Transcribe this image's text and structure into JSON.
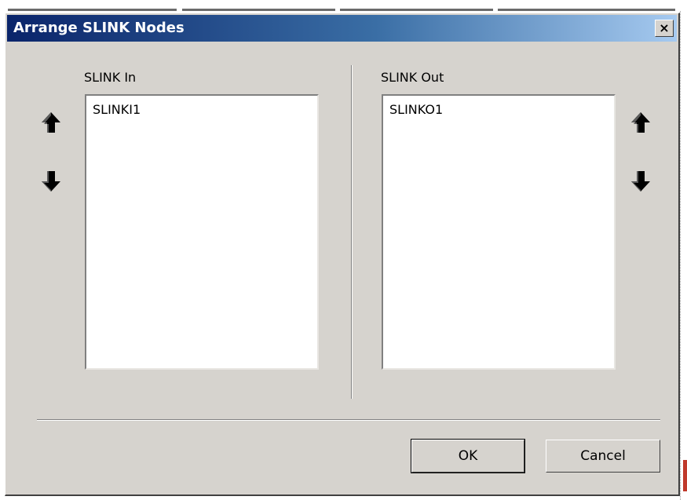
{
  "dialog": {
    "title": "Arrange SLINK Nodes",
    "close_label": "×"
  },
  "slink_in": {
    "label": "SLINK In",
    "items": [
      "SLINKI1"
    ]
  },
  "slink_out": {
    "label": "SLINK Out",
    "items": [
      "SLINKO1"
    ]
  },
  "buttons": {
    "ok": "OK",
    "cancel": "Cancel"
  },
  "icons": {
    "up": "arrow-up-icon",
    "down": "arrow-down-icon",
    "close": "close-icon"
  },
  "colors": {
    "title_gradient_start": "#0a246a",
    "title_gradient_end": "#a6caf0",
    "dialog_face": "#d6d3ce"
  }
}
